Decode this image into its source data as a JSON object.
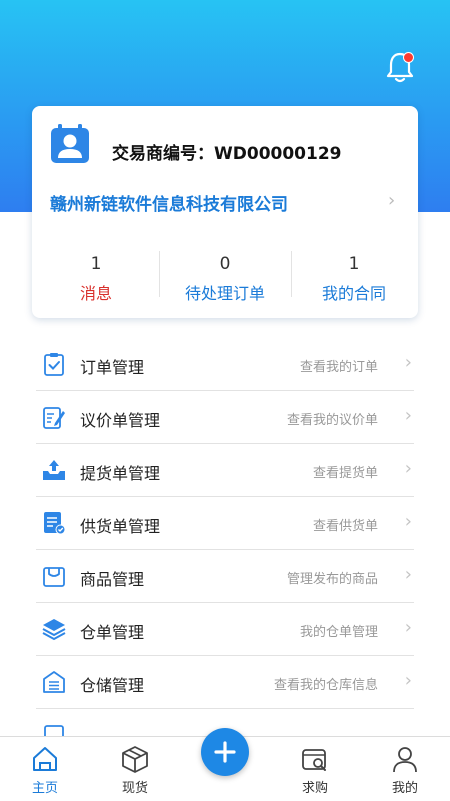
{
  "header": {
    "bell_icon": "bell-icon",
    "has_notification": true
  },
  "card": {
    "trader_label": "交易商编号：",
    "trader_id": "WD00000129",
    "company": "赣州新链软件信息科技有限公司",
    "stats": [
      {
        "value": "1",
        "label": "消息",
        "color": "#d9302c"
      },
      {
        "value": "0",
        "label": "待处理订单",
        "color": "#1b7bd8"
      },
      {
        "value": "1",
        "label": "我的合同",
        "color": "#1b7bd8"
      }
    ]
  },
  "menu": [
    {
      "title": "订单管理",
      "desc": "查看我的订单",
      "icon": "clipboard-check-icon"
    },
    {
      "title": "议价单管理",
      "desc": "查看我的议价单",
      "icon": "edit-document-icon"
    },
    {
      "title": "提货单管理",
      "desc": "查看提货单",
      "icon": "tray-upload-icon"
    },
    {
      "title": "供货单管理",
      "desc": "查看供货单",
      "icon": "document-check-icon"
    },
    {
      "title": "商品管理",
      "desc": "管理发布的商品",
      "icon": "product-box-icon"
    },
    {
      "title": "仓单管理",
      "desc": "我的仓单管理",
      "icon": "layers-icon"
    },
    {
      "title": "仓储管理",
      "desc": "查看我的仓库信息",
      "icon": "warehouse-icon"
    }
  ],
  "tabbar": {
    "tabs": [
      {
        "label": "主页",
        "icon": "home-icon",
        "active": true
      },
      {
        "label": "现货",
        "icon": "cube-icon",
        "active": false
      },
      {
        "label": "求购",
        "icon": "search-wallet-icon",
        "active": false
      },
      {
        "label": "我的",
        "icon": "user-icon",
        "active": false
      }
    ],
    "fab_icon": "plus-icon"
  },
  "colors": {
    "primary": "#1b7bd8",
    "accent_red": "#d9302c",
    "header_top": "#27c3f3",
    "header_bottom": "#2e7ef0"
  }
}
